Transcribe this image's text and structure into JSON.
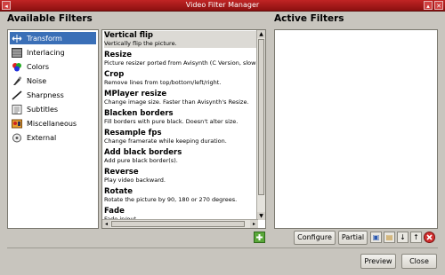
{
  "window": {
    "title": "Video Filter Manager",
    "accent": "#b01818"
  },
  "available": {
    "title": "Available Filters",
    "categories": [
      {
        "label": "Transform",
        "icon": "transform-icon",
        "selected": true
      },
      {
        "label": "Interlacing",
        "icon": "interlacing-icon"
      },
      {
        "label": "Colors",
        "icon": "colors-icon"
      },
      {
        "label": "Noise",
        "icon": "noise-icon"
      },
      {
        "label": "Sharpness",
        "icon": "sharpness-icon"
      },
      {
        "label": "Subtitles",
        "icon": "subtitles-icon"
      },
      {
        "label": "Miscellaneous",
        "icon": "miscellaneous-icon"
      },
      {
        "label": "External",
        "icon": "external-icon"
      }
    ],
    "filters": [
      {
        "name": "Vertical flip",
        "desc": "Vertically flip the picture.",
        "selected": true
      },
      {
        "name": "Resize",
        "desc": "Picture resizer ported from Avisynth (C Version, slow"
      },
      {
        "name": "Crop",
        "desc": "Remove lines from top/bottom/left/right."
      },
      {
        "name": "MPlayer resize",
        "desc": "Change image size. Faster than Avisynth's Resize."
      },
      {
        "name": "Blacken borders",
        "desc": "Fill borders with pure black. Doesn't alter size."
      },
      {
        "name": "Resample fps",
        "desc": "Change framerate while keeping duration."
      },
      {
        "name": "Add black borders",
        "desc": "Add pure black border(s)."
      },
      {
        "name": "Reverse",
        "desc": "Play video backward."
      },
      {
        "name": "Rotate",
        "desc": "Rotate the picture by 90, 180 or 270 degrees."
      },
      {
        "name": "Fade",
        "desc": "Fade in/out."
      }
    ]
  },
  "active": {
    "title": "Active Filters"
  },
  "buttons": {
    "configure": "Configure",
    "partial": "Partial",
    "preview": "Preview",
    "close": "Close"
  }
}
